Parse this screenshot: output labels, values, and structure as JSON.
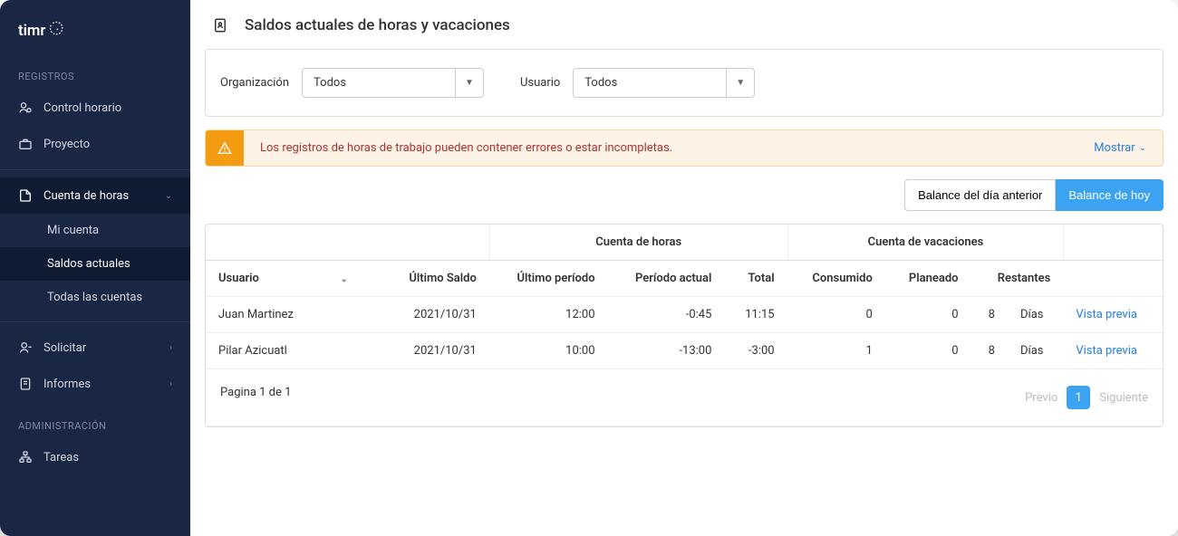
{
  "brand": "timr",
  "sidebar": {
    "sections": {
      "registros_label": "REGISTROS",
      "admin_label": "ADMINISTRACIÓN"
    },
    "items": {
      "control_horario": "Control horario",
      "proyecto": "Proyecto",
      "cuenta_de_horas": "Cuenta de horas",
      "solicitar": "Solicitar",
      "informes": "Informes",
      "tareas": "Tareas"
    },
    "subitems": {
      "mi_cuenta": "Mi cuenta",
      "saldos_actuales": "Saldos actuales",
      "todas_las_cuentas": "Todas las cuentas"
    }
  },
  "page": {
    "title": "Saldos actuales de horas y vacaciones"
  },
  "filters": {
    "org_label": "Organización",
    "org_value": "Todos",
    "user_label": "Usuario",
    "user_value": "Todos"
  },
  "alert": {
    "text": "Los registros de horas de trabajo pueden contener errores o estar incompletas.",
    "action": "Mostrar"
  },
  "toggle": {
    "prev": "Balance del día anterior",
    "today": "Balance de hoy"
  },
  "table": {
    "group_horas": "Cuenta de horas",
    "group_vacaciones": "Cuenta de vacaciones",
    "cols": {
      "usuario": "Usuario",
      "ultimo_saldo": "Último Saldo",
      "ultimo_periodo": "Último período",
      "periodo_actual": "Período actual",
      "total": "Total",
      "consumido": "Consumido",
      "planeado": "Planeado",
      "restantes": "Restantes"
    },
    "rows": [
      {
        "usuario": "Juan Martinez",
        "ultimo_saldo": "2021/10/31",
        "ultimo_periodo": "12:00",
        "periodo_actual": "-0:45",
        "total": "11:15",
        "consumido": "0",
        "planeado": "0",
        "restantes": "8",
        "unidad": "Días",
        "accion": "Vista previa"
      },
      {
        "usuario": "Pilar Azicuatl",
        "ultimo_saldo": "2021/10/31",
        "ultimo_periodo": "10:00",
        "periodo_actual": "-13:00",
        "total": "-3:00",
        "consumido": "1",
        "planeado": "0",
        "restantes": "8",
        "unidad": "Días",
        "accion": "Vista previa"
      }
    ]
  },
  "pagination": {
    "text": "Pagina 1 de 1",
    "prev": "Previo",
    "current": "1",
    "next": "Siguiente"
  }
}
